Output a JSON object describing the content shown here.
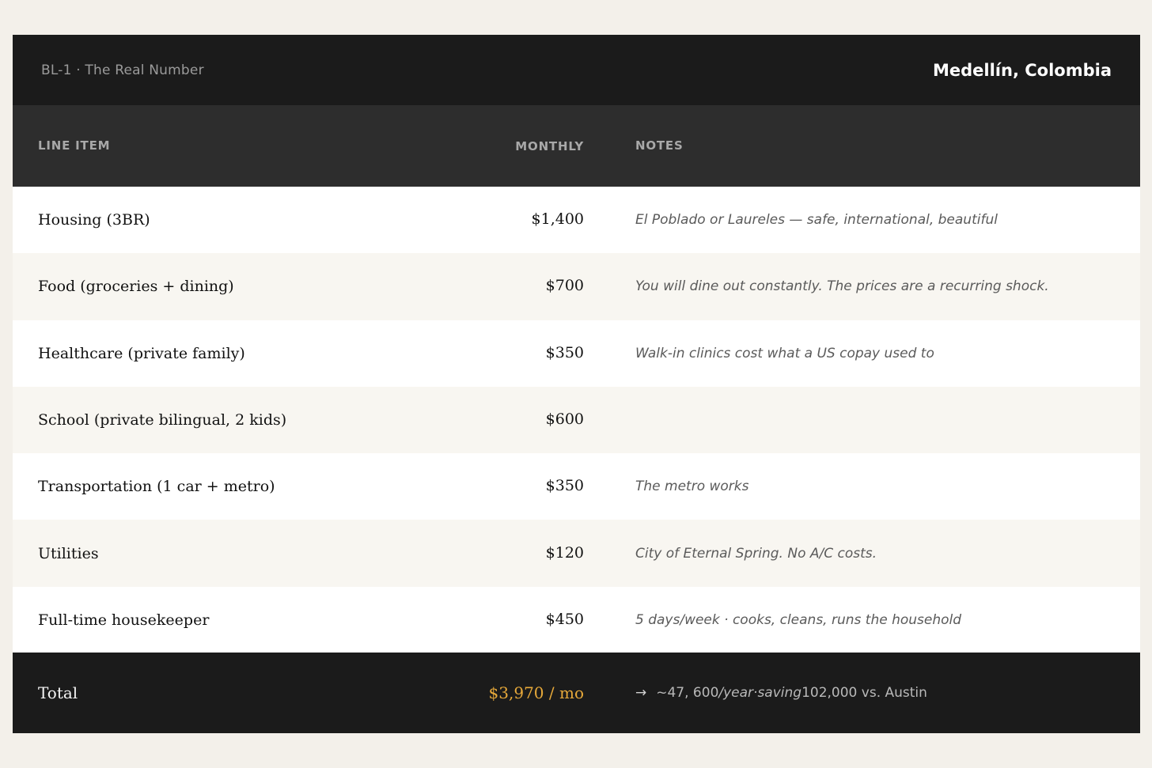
{
  "header": {
    "code": "BL-1 · The Real Number",
    "city": "Medellín, Colombia"
  },
  "table": {
    "columns": {
      "item": "LINE ITEM",
      "monthly": "MONTHLY",
      "notes": "NOTES"
    },
    "rows": [
      {
        "item": "Housing (3BR)",
        "monthly": "$1,400",
        "note": "El Poblado or Laureles — safe, international, beautiful"
      },
      {
        "item": "Food (groceries + dining)",
        "monthly": "$700",
        "note": "You will dine out constantly. The prices are a recurring shock."
      },
      {
        "item": "Healthcare (private family)",
        "monthly": "$350",
        "note": "Walk-in clinics cost what a US copay used to"
      },
      {
        "item": "School (private bilingual, 2 kids)",
        "monthly": "$600",
        "note": ""
      },
      {
        "item": "Transportation (1 car + metro)",
        "monthly": "$350",
        "note": "The metro works"
      },
      {
        "item": "Utilities",
        "monthly": "$120",
        "note": "City of Eternal Spring. No A/C costs."
      },
      {
        "item": "Full-time housekeeper",
        "monthly": "$450",
        "note": "5 days/week · cooks, cleans, runs the household"
      }
    ],
    "total": {
      "label": "Total",
      "monthly": "$3,970 / mo",
      "arrow": "→",
      "note_a": "~47, 600",
      "note_b": "/year·saving",
      "note_c": "102,000 vs. Austin"
    }
  },
  "colors": {
    "accent": "#e7a93a",
    "dark": "#1b1b1b",
    "header_band": "#2d2d2d",
    "alt_row": "#f8f6f1"
  }
}
